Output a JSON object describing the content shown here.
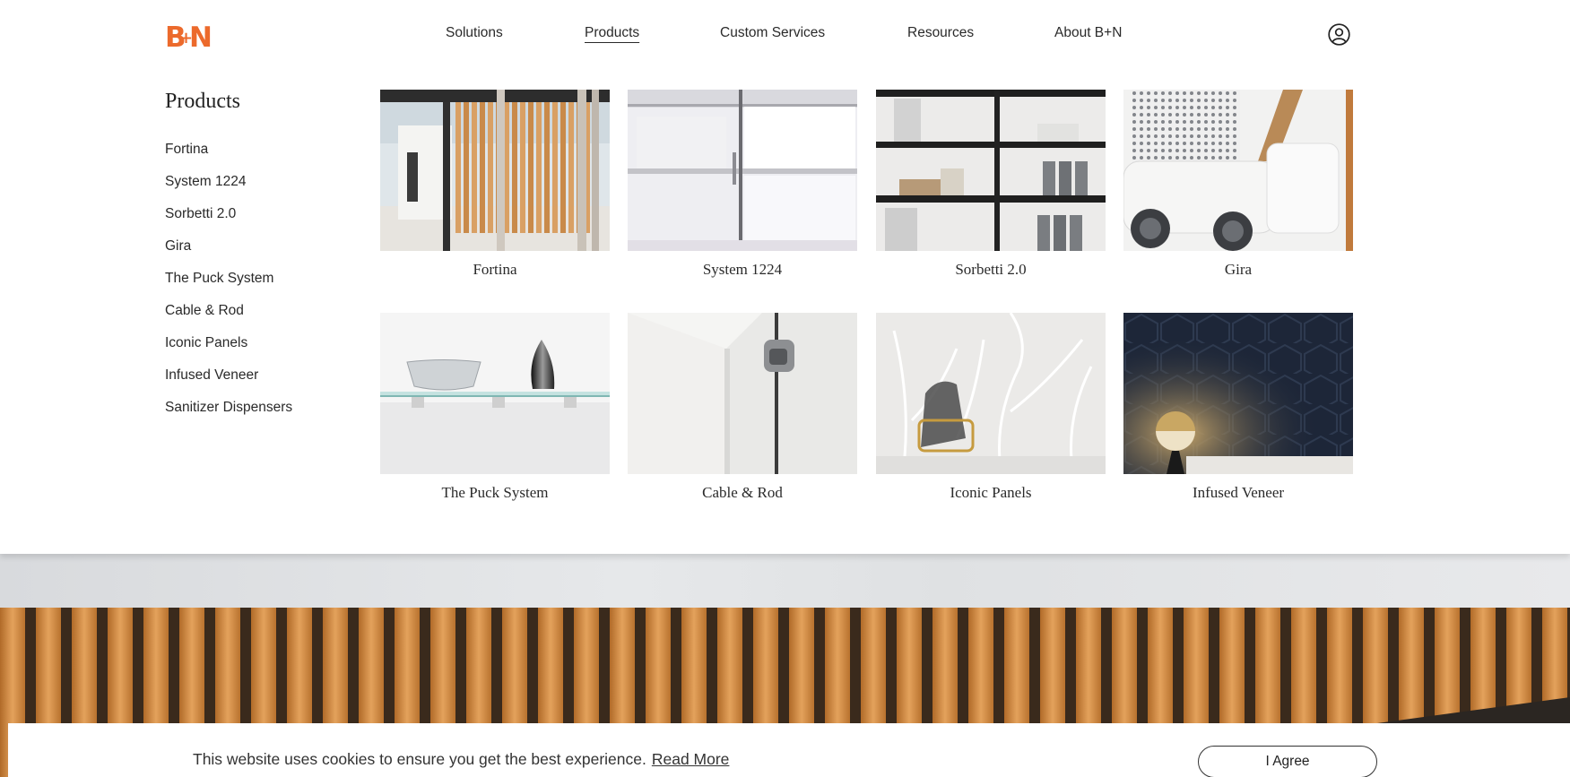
{
  "brand": {
    "logo_text": "B+N",
    "accent_color": "#ec6a2c"
  },
  "nav": {
    "items": [
      {
        "label": "Solutions"
      },
      {
        "label": "Products"
      },
      {
        "label": "Custom Services"
      },
      {
        "label": "Resources"
      },
      {
        "label": "About B+N"
      }
    ],
    "active": "Products",
    "account_icon": "user-circle-icon"
  },
  "menu": {
    "title": "Products",
    "side_items": [
      "Fortina",
      "System 1224",
      "Sorbetti 2.0",
      "Gira",
      "The Puck System",
      "Cable & Rod",
      "Iconic Panels",
      "Infused Veneer",
      "Sanitizer Dispensers"
    ],
    "cards": [
      {
        "label": "Fortina"
      },
      {
        "label": "System 1224"
      },
      {
        "label": "Sorbetti 2.0"
      },
      {
        "label": "Gira"
      },
      {
        "label": "The Puck System"
      },
      {
        "label": "Cable & Rod"
      },
      {
        "label": "Iconic Panels"
      },
      {
        "label": "Infused Veneer"
      }
    ]
  },
  "cookie": {
    "text": "This website uses cookies to ensure you get the best experience.",
    "link": "Read More",
    "button": "I Agree"
  }
}
